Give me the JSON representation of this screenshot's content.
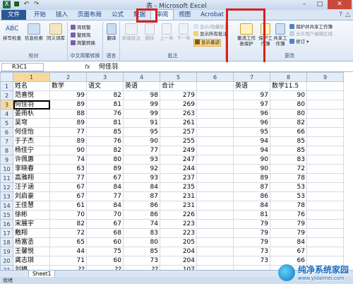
{
  "window": {
    "title": "表 - Microsoft Excel",
    "min": "–",
    "max": "□",
    "close": "✕"
  },
  "tabs": [
    "文件",
    "开始",
    "插入",
    "页面布局",
    "公式",
    "数据",
    "审阅",
    "视图",
    "Acrobat"
  ],
  "ribbon": {
    "proofing": {
      "label": "校对",
      "spell": "拼写检查",
      "research": "信息检索",
      "thesaurus": "同义词库"
    },
    "chinese": {
      "label": "中文简繁转换",
      "to_trad": "简转繁",
      "to_simp": "繁转简",
      "convert": "简繁转换"
    },
    "language": {
      "label": "语言",
      "translate": "翻译"
    },
    "comments": {
      "label": "批注",
      "new": "新建批注",
      "delete": "删除",
      "prev": "上一条",
      "next": "下一条",
      "show_hide": "显示/隐藏批注",
      "show_all": "显示所有批注",
      "show_ink": "显示墨迹"
    },
    "changes": {
      "label": "更改",
      "unprotect_sheet": "撤消工作表保护",
      "protect_workbook": "保护工作簿",
      "share_workbook": "共享工作簿",
      "protect_share": "保护并共享工作簿",
      "allow_edit": "允许用户编辑区域",
      "track": "修订"
    }
  },
  "formula_bar": {
    "name_box": "R3C1",
    "fx": "fx",
    "content": "何佳羽"
  },
  "columns": [
    "1",
    "2",
    "3",
    "4",
    "5",
    "6",
    "7",
    "8",
    "9"
  ],
  "rows": [
    [
      "姓名",
      "数学",
      "语文",
      "英语",
      "合计",
      "",
      "英语",
      "数学11.5",
      ""
    ],
    [
      "范喜悦",
      "99",
      "82",
      "98",
      "279",
      "",
      "97",
      "90",
      ""
    ],
    [
      "何佳羽",
      "89",
      "81",
      "99",
      "269",
      "",
      "97",
      "80",
      ""
    ],
    [
      "姜雨杁",
      "88",
      "76",
      "99",
      "263",
      "",
      "96",
      "80",
      ""
    ],
    [
      "吴穹",
      "89",
      "81",
      "91",
      "261",
      "",
      "96",
      "82",
      ""
    ],
    [
      "何佳怡",
      "77",
      "85",
      "95",
      "257",
      "",
      "95",
      "66",
      ""
    ],
    [
      "于子杰",
      "89",
      "76",
      "90",
      "255",
      "",
      "94",
      "85",
      ""
    ],
    [
      "杨佳宁",
      "90",
      "82",
      "77",
      "249",
      "",
      "94",
      "85",
      ""
    ],
    [
      "许佩蕙",
      "74",
      "80",
      "93",
      "247",
      "",
      "90",
      "83",
      ""
    ],
    [
      "李晓春",
      "63",
      "89",
      "92",
      "244",
      "",
      "90",
      "72",
      ""
    ],
    [
      "高雅翔",
      "77",
      "67",
      "93",
      "237",
      "",
      "89",
      "78",
      ""
    ],
    [
      "汪子涵",
      "67",
      "84",
      "84",
      "235",
      "",
      "87",
      "53",
      ""
    ],
    [
      "刘启豪",
      "67",
      "77",
      "87",
      "231",
      "",
      "86",
      "53",
      ""
    ],
    [
      "王佳慧",
      "61",
      "84",
      "86",
      "231",
      "",
      "84",
      "78",
      ""
    ],
    [
      "徐彬",
      "70",
      "70",
      "86",
      "226",
      "",
      "81",
      "76",
      ""
    ],
    [
      "宋展宇",
      "82",
      "67",
      "74",
      "223",
      "",
      "79",
      "79",
      ""
    ],
    [
      "敷翔",
      "72",
      "68",
      "83",
      "223",
      "",
      "79",
      "79",
      ""
    ],
    [
      "杨富丞",
      "65",
      "60",
      "80",
      "205",
      "",
      "79",
      "84",
      ""
    ],
    [
      "王馨悦",
      "44",
      "75",
      "85",
      "204",
      "",
      "73",
      "67",
      ""
    ],
    [
      "龚志琪",
      "71",
      "60",
      "73",
      "204",
      "",
      "73",
      "66",
      ""
    ],
    [
      "刘婷",
      "??",
      "??",
      "??",
      "107",
      "",
      "",
      "",
      ""
    ]
  ],
  "sheet_tab": "Sheet1",
  "status": "就绪",
  "watermark": {
    "title": "纯净系统家园",
    "url": "www.yidaimei.com"
  },
  "colors": {
    "highlight": "#d8211d",
    "file_tab": "#2b5797",
    "selected_header": "#f9d99a"
  }
}
